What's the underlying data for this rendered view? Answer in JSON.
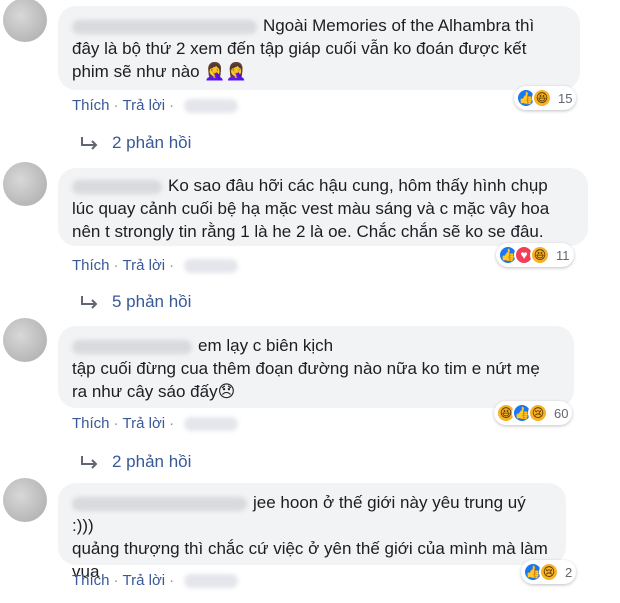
{
  "comments": [
    {
      "text_lines": [
        "Ngoài Memories of the Alhambra thì",
        "đây là bộ thứ 2 xem đến tập giáp cuối vẫn ko đoán được kết",
        "phim sẽ như nào 🤦‍♀️🤦‍♀️"
      ],
      "like_label": "Thích",
      "reply_label": "Trả lời",
      "reaction_icons": [
        "like-icon",
        "haha-icon"
      ],
      "reaction_count": "15",
      "replies_label": "2 phản hồi"
    },
    {
      "text_lines": [
        "Ko sao đâu hỡi các hậu cung, hôm thấy hình chụp",
        "lúc quay cảnh cuối bệ hạ mặc vest màu sáng và c mặc vây hoa",
        "nên t strongly tin rằng 1 là he 2 là oe. Chắc chắn sẽ ko se đâu."
      ],
      "like_label": "Thích",
      "reply_label": "Trả lời",
      "reaction_icons": [
        "like-icon",
        "love-icon",
        "haha-icon"
      ],
      "reaction_count": "11",
      "replies_label": "5 phản hồi"
    },
    {
      "text_lines": [
        "em lạy c biên kịch",
        "tập cuối đừng cua thêm đoạn đường nào nữa ko tim e nứt mẹ",
        "ra như cây sáo đấy😞"
      ],
      "like_label": "Thích",
      "reply_label": "Trả lời",
      "reaction_icons": [
        "haha-icon",
        "like-icon",
        "sad-icon"
      ],
      "reaction_count": "60",
      "replies_label": "2 phản hồi"
    },
    {
      "text_lines": [
        "jee hoon ở thế giới này yêu trung uý :)))",
        "quảng thượng thì chắc cứ việc ở yên thế giới của mình mà làm",
        "vua"
      ],
      "like_label": "Thích",
      "reply_label": "Trả lời",
      "reaction_icons": [
        "like-icon",
        "sad-icon"
      ],
      "reaction_count": "2"
    }
  ],
  "colors": {
    "link": "#385898",
    "bubble": "#f2f3f5",
    "like": "#1877f2",
    "love": "#f33e58",
    "haha": "#f7b125"
  }
}
